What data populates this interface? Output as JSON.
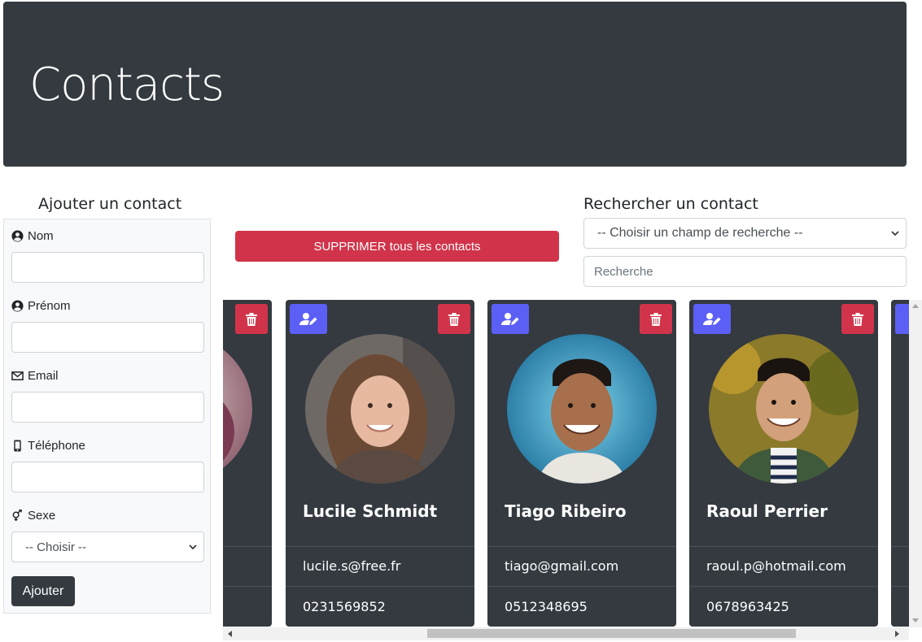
{
  "header": {
    "title": "Contacts"
  },
  "add_form": {
    "title": "Ajouter un contact",
    "fields": {
      "nom": {
        "label": "Nom",
        "value": ""
      },
      "prenom": {
        "label": "Prénom",
        "value": ""
      },
      "email": {
        "label": "Email",
        "value": ""
      },
      "telephone": {
        "label": "Téléphone",
        "value": ""
      },
      "sexe": {
        "label": "Sexe",
        "selected": "-- Choisir --"
      }
    },
    "submit_label": "Ajouter"
  },
  "delete_all_label": "SUPPRIMER tous les contacts",
  "search": {
    "title": "Rechercher un contact",
    "field_select": "-- Choisir un champ de recherche --",
    "placeholder": "Recherche"
  },
  "contacts": [
    {
      "name": "Lucile Schmidt",
      "email": "lucile.s@free.fr",
      "phone": "0231569852",
      "photo": "woman-long-hair"
    },
    {
      "name": "Tiago Ribeiro",
      "email": "tiago@gmail.com",
      "phone": "0512348695",
      "photo": "man-smiling-blue"
    },
    {
      "name": "Raoul Perrier",
      "email": "raoul.p@hotmail.com",
      "phone": "0678963425",
      "photo": "man-green-jacket"
    }
  ],
  "colors": {
    "header_bg": "#343a40",
    "card_bg": "#343a40",
    "danger": "#d1344a",
    "edit": "#5b5ff5"
  }
}
